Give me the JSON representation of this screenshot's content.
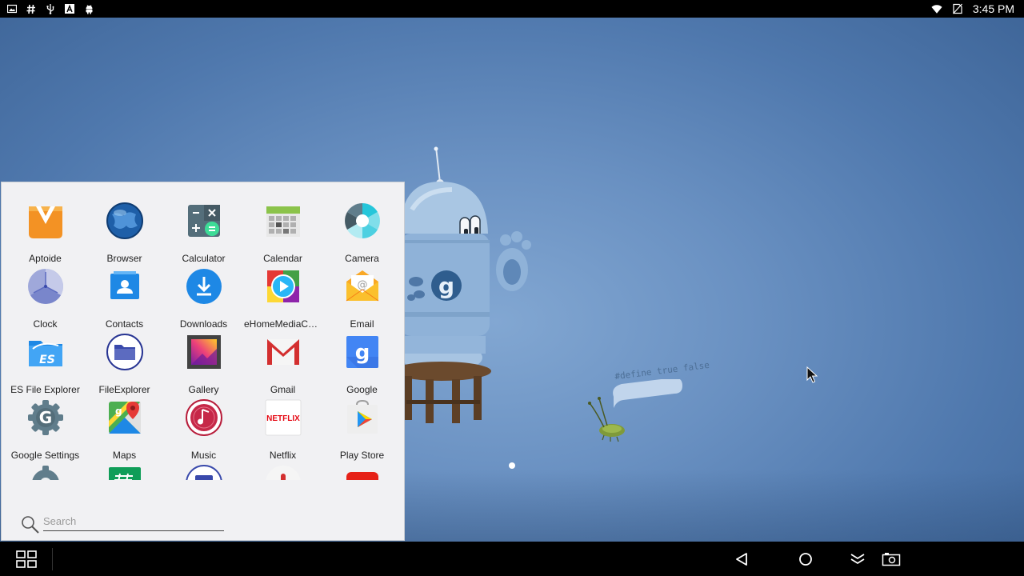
{
  "status_bar": {
    "left_icons": [
      "image-icon",
      "hash-icon",
      "usb-icon",
      "font-icon",
      "android-icon"
    ],
    "right_icons": [
      "wifi-icon",
      "no-sim-icon"
    ],
    "time": "3:45 PM"
  },
  "wallpaper": {
    "speech_bubble": "#define true false"
  },
  "drawer": {
    "apps": [
      {
        "label": "Aptoide",
        "icon": "aptoide-icon"
      },
      {
        "label": "Browser",
        "icon": "globe-icon"
      },
      {
        "label": "Calculator",
        "icon": "calculator-icon"
      },
      {
        "label": "Calendar",
        "icon": "calendar-icon"
      },
      {
        "label": "Camera",
        "icon": "camera-aperture-icon"
      },
      {
        "label": "Clock",
        "icon": "clock-icon"
      },
      {
        "label": "Contacts",
        "icon": "contacts-icon"
      },
      {
        "label": "Downloads",
        "icon": "download-icon"
      },
      {
        "label": "eHomeMediaCen...",
        "icon": "media-play-icon"
      },
      {
        "label": "Email",
        "icon": "email-envelope-icon"
      },
      {
        "label": "ES File Explorer",
        "icon": "es-folder-icon"
      },
      {
        "label": "FileExplorer",
        "icon": "folder-icon"
      },
      {
        "label": "Gallery",
        "icon": "gallery-icon"
      },
      {
        "label": "Gmail",
        "icon": "gmail-icon"
      },
      {
        "label": "Google",
        "icon": "google-icon"
      },
      {
        "label": "Google Settings",
        "icon": "google-settings-icon"
      },
      {
        "label": "Maps",
        "icon": "maps-icon"
      },
      {
        "label": "Music",
        "icon": "music-icon"
      },
      {
        "label": "Netflix",
        "icon": "netflix-icon",
        "text": "NETFLIX"
      },
      {
        "label": "Play Store",
        "icon": "play-store-icon"
      },
      {
        "label": "",
        "icon": "settings-icon"
      },
      {
        "label": "",
        "icon": "hangouts-icon"
      },
      {
        "label": "",
        "icon": "tv-icon"
      },
      {
        "label": "",
        "icon": "voice-icon"
      },
      {
        "label": "",
        "icon": "youtube-icon"
      }
    ],
    "search_placeholder": "Search"
  },
  "nav_bar": {
    "buttons": [
      "all-apps-icon",
      "back-icon",
      "home-icon",
      "hide-bar-icon",
      "screenshot-icon"
    ]
  },
  "colors": {
    "drawer_bg": "#f1f1f3",
    "wallpaper_center": "#82a7d2",
    "wallpaper_edge": "#3f6699"
  }
}
